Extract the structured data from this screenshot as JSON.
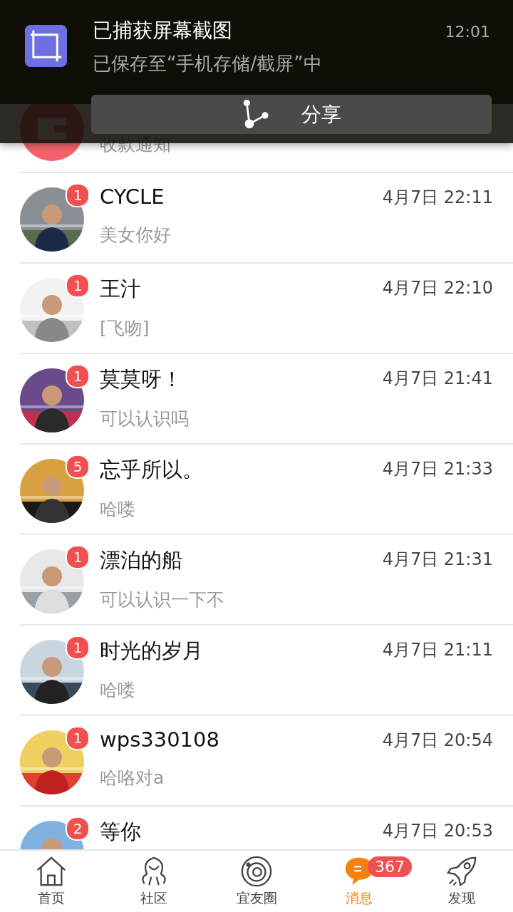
{
  "notification": {
    "title": "已捕获屏幕截图",
    "subtitle": "已保存至“手机存储/截屏”中",
    "time": "12:01",
    "action": "分享"
  },
  "conversations": [
    {
      "kind": "notice",
      "preview": "收款通知"
    },
    {
      "kind": "picture",
      "name": "CYCLE",
      "preview": "美女你好",
      "time": "4月7日 22:11",
      "unread": "1"
    },
    {
      "kind": "picture",
      "name": "王汁",
      "preview": "[飞吻]",
      "time": "4月7日 22:10",
      "unread": "1"
    },
    {
      "kind": "picture",
      "name": "莫莫呀！",
      "preview": "可以认识吗",
      "time": "4月7日 21:41",
      "unread": "1"
    },
    {
      "kind": "picture",
      "name": "忘乎所以。",
      "preview": "哈喽",
      "time": "4月7日 21:33",
      "unread": "5"
    },
    {
      "kind": "picture",
      "name": "漂泊的船",
      "preview": "可以认识一下不",
      "time": "4月7日 21:31",
      "unread": "1"
    },
    {
      "kind": "picture",
      "name": "时光的岁月",
      "preview": "哈喽",
      "time": "4月7日 21:11",
      "unread": "1"
    },
    {
      "kind": "picture",
      "name": "wps330108",
      "preview": "哈咯对a",
      "time": "4月7日 20:54",
      "unread": "1"
    },
    {
      "kind": "picture",
      "name": "等你",
      "time": "4月7日 20:53",
      "unread": "2"
    }
  ],
  "nav": [
    {
      "kind": "home",
      "label": "首页",
      "selected": false
    },
    {
      "kind": "community",
      "label": "社区",
      "selected": false
    },
    {
      "kind": "orbit",
      "label": "宜友圈",
      "selected": false
    },
    {
      "kind": "chat",
      "label": "消息",
      "selected": true,
      "badge": "367"
    },
    {
      "kind": "rocket",
      "label": "发现",
      "selected": false
    }
  ]
}
